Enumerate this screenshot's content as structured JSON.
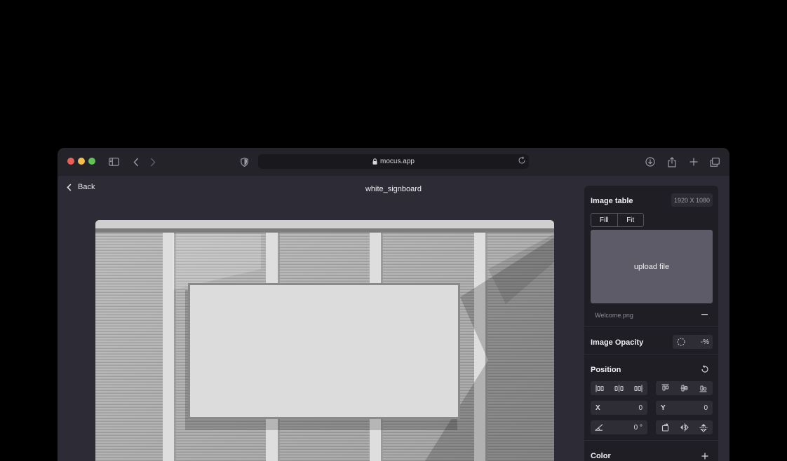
{
  "browser": {
    "url": "mocus.app",
    "traffic_lights": [
      "#ec5f57",
      "#f4bd4f",
      "#5fc454"
    ]
  },
  "app": {
    "back_label": "Back",
    "document_title": "white_signboard"
  },
  "panel": {
    "image_table": {
      "title": "Image table",
      "resolution": "1920 X 1080",
      "fill_label": "Fill",
      "fit_label": "Fit",
      "upload_label": "upload file",
      "filename": "Welcome.png"
    },
    "opacity": {
      "title": "Image Opacity",
      "value": "-%"
    },
    "position": {
      "title": "Position",
      "x_label": "X",
      "x_value": "0",
      "y_label": "Y",
      "y_value": "0",
      "rotation_value": "0 °"
    },
    "color": {
      "title": "Color"
    }
  },
  "colors": {
    "window_bg": "#2b2a33",
    "panel_bg": "#1f1e25",
    "upload_bg": "#5c5b67"
  }
}
